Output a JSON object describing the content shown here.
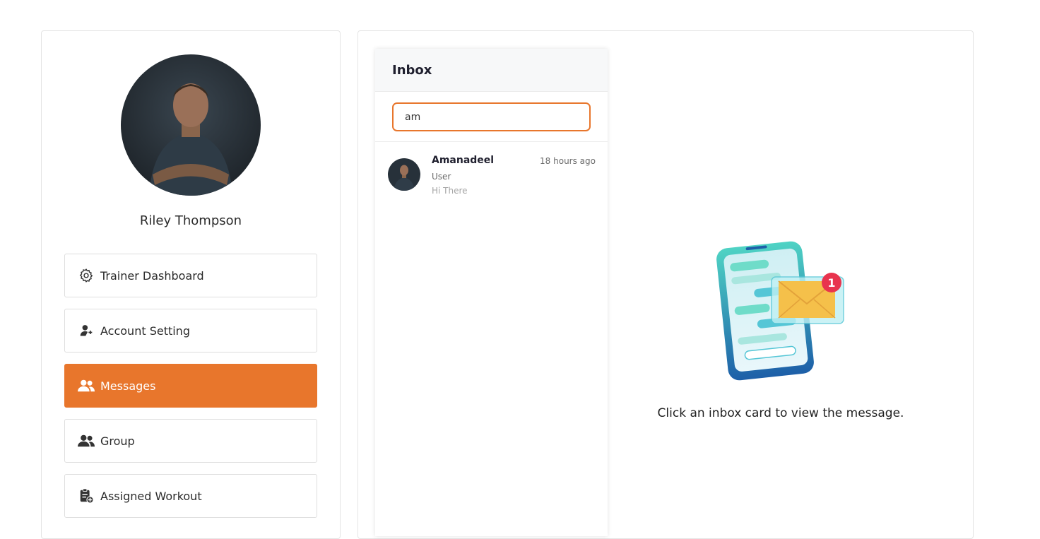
{
  "profile": {
    "name": "Riley Thompson"
  },
  "menu": {
    "items": [
      {
        "label": "Trainer Dashboard",
        "icon": "gear-icon"
      },
      {
        "label": "Account Setting",
        "icon": "user-edit-icon"
      },
      {
        "label": "Messages",
        "icon": "users-icon",
        "active": true
      },
      {
        "label": "Group",
        "icon": "users-icon"
      },
      {
        "label": "Assigned Workout",
        "icon": "clipboard-add-icon"
      }
    ]
  },
  "inbox": {
    "title": "Inbox",
    "search_value": "am",
    "cards": [
      {
        "name": "Amanadeel",
        "time": "18 hours ago",
        "role": "User",
        "preview": "Hi There"
      }
    ]
  },
  "empty_state": {
    "text": "Click an inbox card to view the message.",
    "badge_count": "1"
  },
  "colors": {
    "accent": "#e8762c",
    "phone_teal": "#2bb3c0",
    "envelope_yellow": "#f5c04a",
    "badge_red": "#e8344e"
  }
}
